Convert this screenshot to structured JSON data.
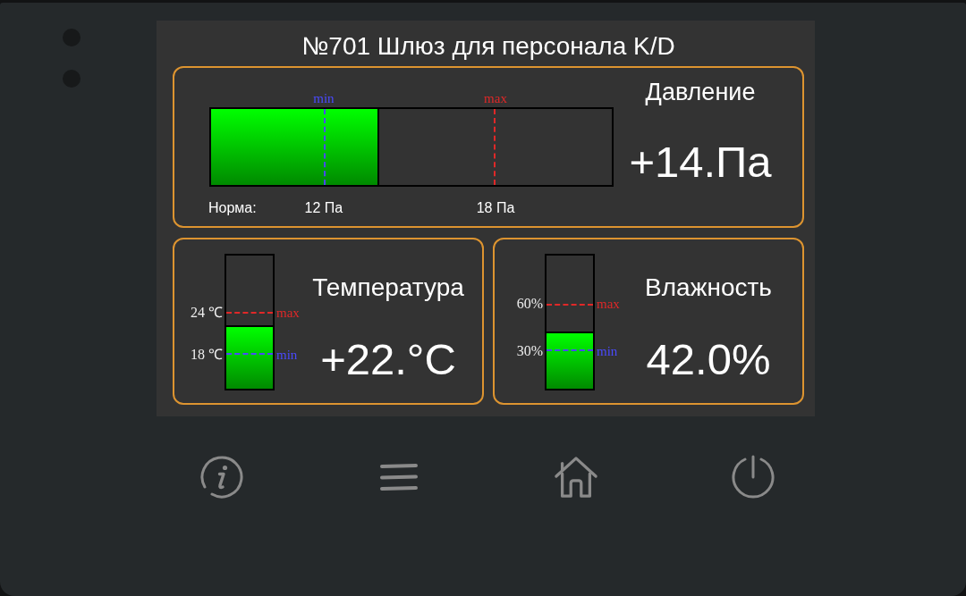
{
  "screen": {
    "title": "№701 Шлюз для персонала K/D"
  },
  "pressure": {
    "label": "Давление",
    "value": "+14.Па",
    "level": 0.42,
    "norm_label": "Норма:",
    "markers": [
      {
        "label": "min",
        "reading": "12 Па",
        "level": 0.283,
        "color": "#4a4aff"
      },
      {
        "label": "max",
        "reading": "18 Па",
        "level": 0.708,
        "color": "#e02828"
      }
    ]
  },
  "gauges": [
    {
      "label": "Температура",
      "value": "+22.°C",
      "level": 0.477,
      "markers": [
        {
          "label": "max",
          "reading": "24 ℃",
          "level": 0.569,
          "color": "#e02828"
        },
        {
          "label": "min",
          "reading": "18 ℃",
          "level": 0.261,
          "color": "#4a4aff"
        }
      ]
    },
    {
      "label": "Влажность",
      "value": "42.0%",
      "level": 0.43,
      "markers": [
        {
          "label": "max",
          "reading": "60%",
          "level": 0.634,
          "color": "#e02828"
        },
        {
          "label": "min",
          "reading": "30%",
          "level": 0.288,
          "color": "#4a4aff"
        }
      ]
    }
  ],
  "nav_buttons": [
    {
      "kind": "info"
    },
    {
      "kind": "menu"
    },
    {
      "kind": "home"
    },
    {
      "kind": "power"
    }
  ]
}
